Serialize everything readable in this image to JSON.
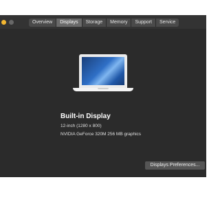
{
  "tabs": [
    {
      "label": "Overview",
      "selected": false
    },
    {
      "label": "Displays",
      "selected": true
    },
    {
      "label": "Storage",
      "selected": false
    },
    {
      "label": "Memory",
      "selected": false
    },
    {
      "label": "Support",
      "selected": false
    },
    {
      "label": "Service",
      "selected": false
    }
  ],
  "display": {
    "name": "Built-in Display",
    "resolution": "12-inch (1280 x 800)",
    "graphics": "NVIDIA GeForce 320M 256 MB graphics",
    "icon": "laptop-icon"
  },
  "preferences_button": {
    "label": "Displays Preferences..."
  },
  "colors": {
    "window_background": "#2b2b2b",
    "selected_tab": "#6a6a6a",
    "minimize_light": "#f4b731"
  }
}
